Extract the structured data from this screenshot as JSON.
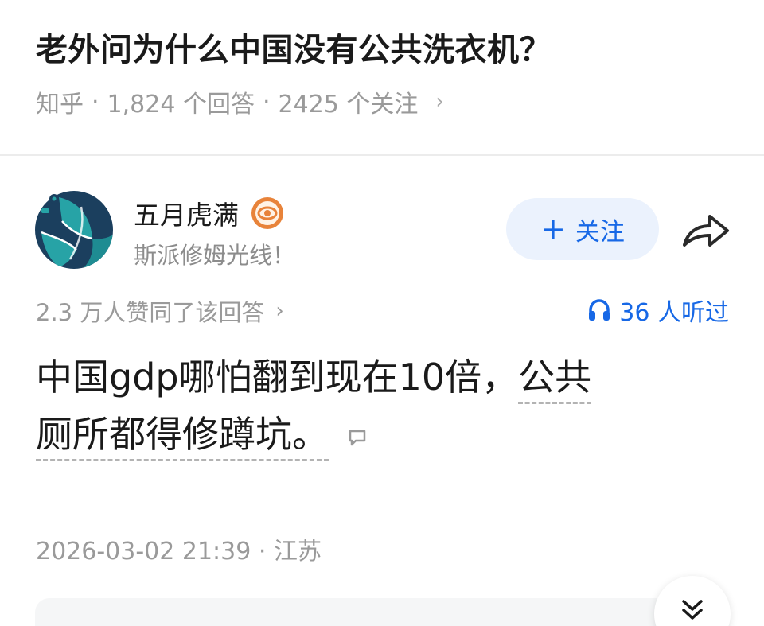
{
  "question": {
    "title": "老外问为什么中国没有公共洗衣机？",
    "source": "知乎",
    "separator": "·",
    "answers_count": "1,824 个回答",
    "followers_count": "2425 个关注",
    "chevron": "›"
  },
  "author": {
    "name": "五月虎满",
    "bio": "斯派修姆光线！",
    "avatar_icon": "volleyball-avatar",
    "badge_icon": "eye-badge-icon"
  },
  "actions": {
    "follow_plus": "+",
    "follow_label": "关注",
    "share_icon": "share-arrow-icon"
  },
  "stats": {
    "votes_text": "2.3 万人赞同了该回答",
    "votes_chevron": "›",
    "listen_text": "36 人听过"
  },
  "answer": {
    "line1_plain": "中国gdp哪怕翻到现在10倍，",
    "line1_highlight": "公共",
    "line2_highlight": "厕所都得修蹲坑。"
  },
  "meta": {
    "timestamp": "2026-03-02 21:39 · 江苏"
  },
  "colors": {
    "accent": "#1768e6",
    "follow_bg": "#ebf2fd",
    "muted_text": "#9a9a9a",
    "badge_orange": "#e8833a",
    "avatar_teal": "#1e8c92",
    "avatar_navy": "#1b3f5e"
  }
}
